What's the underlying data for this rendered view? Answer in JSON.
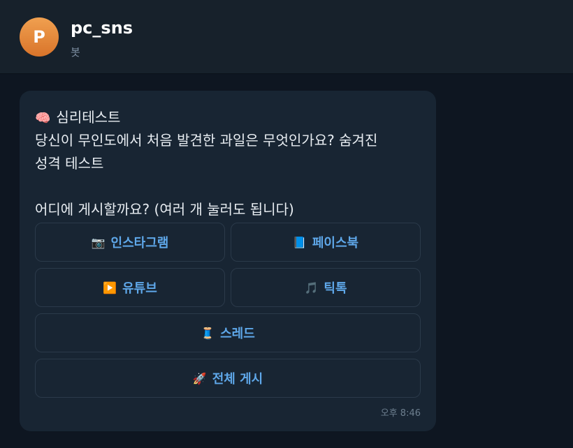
{
  "header": {
    "avatar_letter": "P",
    "title": "pc_sns",
    "subtitle": "봇"
  },
  "message": {
    "line1_icon": "🧠",
    "line1": "심리테스트",
    "line2": "당신이 무인도에서 처음 발견한 과일은 무엇인가요? 숨겨진",
    "line3": "성격 테스트",
    "line5": "어디에 게시할까요? (여러 개 눌러도 됩니다)",
    "time": "오후 8:46"
  },
  "buttons": [
    {
      "icon": "📷",
      "label": "인스타그램"
    },
    {
      "icon": "📘",
      "label": "페이스북"
    },
    {
      "icon": "▶️",
      "label": "유튜브"
    },
    {
      "icon": "🎵",
      "label": "틱톡"
    },
    {
      "icon": "🧵",
      "label": "스레드"
    },
    {
      "icon": "🚀",
      "label": "전체 게시"
    }
  ],
  "colors": {
    "background": "#0e1621",
    "header": "#17212b",
    "bubble": "#182533",
    "button_text": "#5fa8ea",
    "avatar": "#e08838"
  }
}
